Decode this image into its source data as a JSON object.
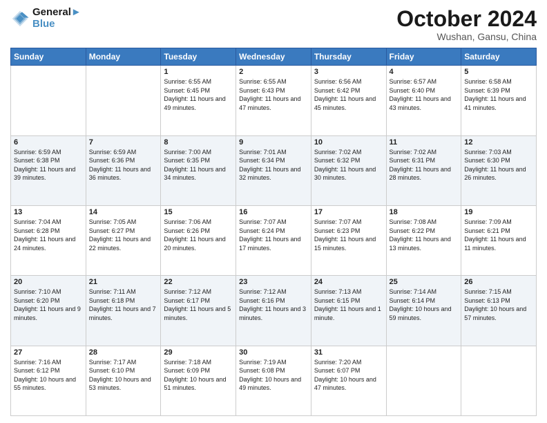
{
  "header": {
    "logo_line1": "General",
    "logo_line2": "Blue",
    "month": "October 2024",
    "location": "Wushan, Gansu, China"
  },
  "weekdays": [
    "Sunday",
    "Monday",
    "Tuesday",
    "Wednesday",
    "Thursday",
    "Friday",
    "Saturday"
  ],
  "weeks": [
    [
      {
        "day": "",
        "sunrise": "",
        "sunset": "",
        "daylight": ""
      },
      {
        "day": "",
        "sunrise": "",
        "sunset": "",
        "daylight": ""
      },
      {
        "day": "1",
        "sunrise": "Sunrise: 6:55 AM",
        "sunset": "Sunset: 6:45 PM",
        "daylight": "Daylight: 11 hours and 49 minutes."
      },
      {
        "day": "2",
        "sunrise": "Sunrise: 6:55 AM",
        "sunset": "Sunset: 6:43 PM",
        "daylight": "Daylight: 11 hours and 47 minutes."
      },
      {
        "day": "3",
        "sunrise": "Sunrise: 6:56 AM",
        "sunset": "Sunset: 6:42 PM",
        "daylight": "Daylight: 11 hours and 45 minutes."
      },
      {
        "day": "4",
        "sunrise": "Sunrise: 6:57 AM",
        "sunset": "Sunset: 6:40 PM",
        "daylight": "Daylight: 11 hours and 43 minutes."
      },
      {
        "day": "5",
        "sunrise": "Sunrise: 6:58 AM",
        "sunset": "Sunset: 6:39 PM",
        "daylight": "Daylight: 11 hours and 41 minutes."
      }
    ],
    [
      {
        "day": "6",
        "sunrise": "Sunrise: 6:59 AM",
        "sunset": "Sunset: 6:38 PM",
        "daylight": "Daylight: 11 hours and 39 minutes."
      },
      {
        "day": "7",
        "sunrise": "Sunrise: 6:59 AM",
        "sunset": "Sunset: 6:36 PM",
        "daylight": "Daylight: 11 hours and 36 minutes."
      },
      {
        "day": "8",
        "sunrise": "Sunrise: 7:00 AM",
        "sunset": "Sunset: 6:35 PM",
        "daylight": "Daylight: 11 hours and 34 minutes."
      },
      {
        "day": "9",
        "sunrise": "Sunrise: 7:01 AM",
        "sunset": "Sunset: 6:34 PM",
        "daylight": "Daylight: 11 hours and 32 minutes."
      },
      {
        "day": "10",
        "sunrise": "Sunrise: 7:02 AM",
        "sunset": "Sunset: 6:32 PM",
        "daylight": "Daylight: 11 hours and 30 minutes."
      },
      {
        "day": "11",
        "sunrise": "Sunrise: 7:02 AM",
        "sunset": "Sunset: 6:31 PM",
        "daylight": "Daylight: 11 hours and 28 minutes."
      },
      {
        "day": "12",
        "sunrise": "Sunrise: 7:03 AM",
        "sunset": "Sunset: 6:30 PM",
        "daylight": "Daylight: 11 hours and 26 minutes."
      }
    ],
    [
      {
        "day": "13",
        "sunrise": "Sunrise: 7:04 AM",
        "sunset": "Sunset: 6:28 PM",
        "daylight": "Daylight: 11 hours and 24 minutes."
      },
      {
        "day": "14",
        "sunrise": "Sunrise: 7:05 AM",
        "sunset": "Sunset: 6:27 PM",
        "daylight": "Daylight: 11 hours and 22 minutes."
      },
      {
        "day": "15",
        "sunrise": "Sunrise: 7:06 AM",
        "sunset": "Sunset: 6:26 PM",
        "daylight": "Daylight: 11 hours and 20 minutes."
      },
      {
        "day": "16",
        "sunrise": "Sunrise: 7:07 AM",
        "sunset": "Sunset: 6:24 PM",
        "daylight": "Daylight: 11 hours and 17 minutes."
      },
      {
        "day": "17",
        "sunrise": "Sunrise: 7:07 AM",
        "sunset": "Sunset: 6:23 PM",
        "daylight": "Daylight: 11 hours and 15 minutes."
      },
      {
        "day": "18",
        "sunrise": "Sunrise: 7:08 AM",
        "sunset": "Sunset: 6:22 PM",
        "daylight": "Daylight: 11 hours and 13 minutes."
      },
      {
        "day": "19",
        "sunrise": "Sunrise: 7:09 AM",
        "sunset": "Sunset: 6:21 PM",
        "daylight": "Daylight: 11 hours and 11 minutes."
      }
    ],
    [
      {
        "day": "20",
        "sunrise": "Sunrise: 7:10 AM",
        "sunset": "Sunset: 6:20 PM",
        "daylight": "Daylight: 11 hours and 9 minutes."
      },
      {
        "day": "21",
        "sunrise": "Sunrise: 7:11 AM",
        "sunset": "Sunset: 6:18 PM",
        "daylight": "Daylight: 11 hours and 7 minutes."
      },
      {
        "day": "22",
        "sunrise": "Sunrise: 7:12 AM",
        "sunset": "Sunset: 6:17 PM",
        "daylight": "Daylight: 11 hours and 5 minutes."
      },
      {
        "day": "23",
        "sunrise": "Sunrise: 7:12 AM",
        "sunset": "Sunset: 6:16 PM",
        "daylight": "Daylight: 11 hours and 3 minutes."
      },
      {
        "day": "24",
        "sunrise": "Sunrise: 7:13 AM",
        "sunset": "Sunset: 6:15 PM",
        "daylight": "Daylight: 11 hours and 1 minute."
      },
      {
        "day": "25",
        "sunrise": "Sunrise: 7:14 AM",
        "sunset": "Sunset: 6:14 PM",
        "daylight": "Daylight: 10 hours and 59 minutes."
      },
      {
        "day": "26",
        "sunrise": "Sunrise: 7:15 AM",
        "sunset": "Sunset: 6:13 PM",
        "daylight": "Daylight: 10 hours and 57 minutes."
      }
    ],
    [
      {
        "day": "27",
        "sunrise": "Sunrise: 7:16 AM",
        "sunset": "Sunset: 6:12 PM",
        "daylight": "Daylight: 10 hours and 55 minutes."
      },
      {
        "day": "28",
        "sunrise": "Sunrise: 7:17 AM",
        "sunset": "Sunset: 6:10 PM",
        "daylight": "Daylight: 10 hours and 53 minutes."
      },
      {
        "day": "29",
        "sunrise": "Sunrise: 7:18 AM",
        "sunset": "Sunset: 6:09 PM",
        "daylight": "Daylight: 10 hours and 51 minutes."
      },
      {
        "day": "30",
        "sunrise": "Sunrise: 7:19 AM",
        "sunset": "Sunset: 6:08 PM",
        "daylight": "Daylight: 10 hours and 49 minutes."
      },
      {
        "day": "31",
        "sunrise": "Sunrise: 7:20 AM",
        "sunset": "Sunset: 6:07 PM",
        "daylight": "Daylight: 10 hours and 47 minutes."
      },
      {
        "day": "",
        "sunrise": "",
        "sunset": "",
        "daylight": ""
      },
      {
        "day": "",
        "sunrise": "",
        "sunset": "",
        "daylight": ""
      }
    ]
  ]
}
